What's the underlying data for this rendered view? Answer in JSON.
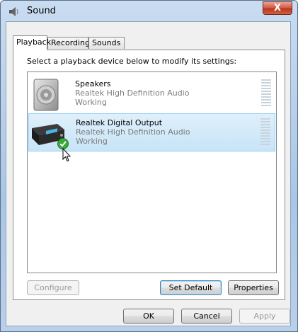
{
  "window": {
    "title": "Sound",
    "close_label": "X"
  },
  "tabs": [
    {
      "label": "Playback",
      "active": true
    },
    {
      "label": "Recording",
      "active": false
    },
    {
      "label": "Sounds",
      "active": false
    }
  ],
  "instruction": "Select a playback device below to modify its settings:",
  "devices": [
    {
      "name": "Speakers",
      "driver": "Realtek High Definition Audio",
      "status": "Working",
      "selected": false,
      "icon": "speaker-icon"
    },
    {
      "name": "Realtek Digital Output",
      "driver": "Realtek High Definition Audio",
      "status": "Working",
      "selected": true,
      "icon": "digital-output-icon",
      "default_badge": "check-icon"
    }
  ],
  "buttons": {
    "configure": "Configure",
    "set_default": "Set Default",
    "properties": "Properties",
    "ok": "OK",
    "cancel": "Cancel",
    "apply": "Apply"
  },
  "colors": {
    "selection": "#c7e4f7",
    "check": "#3aa83a",
    "close": "#d0573f"
  }
}
